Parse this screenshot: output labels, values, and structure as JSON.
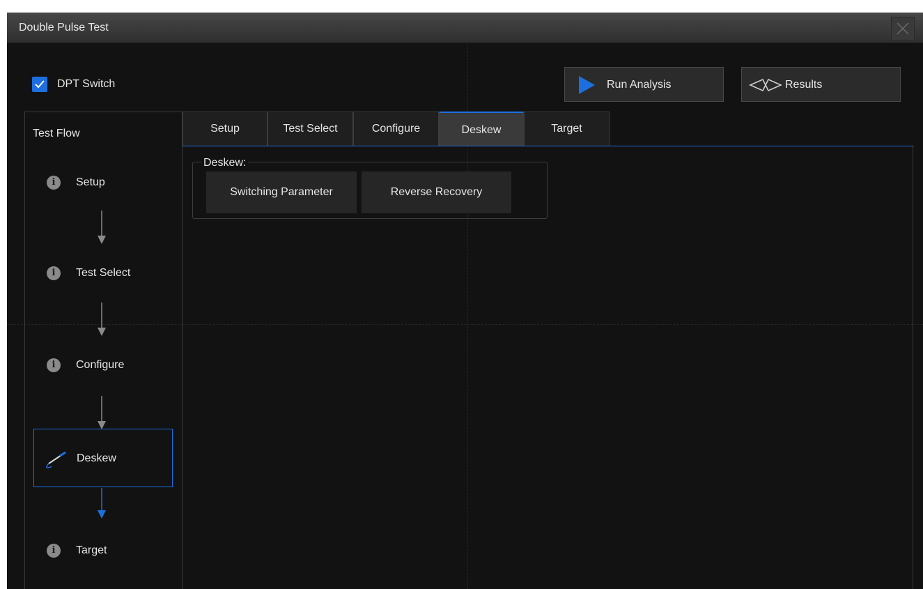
{
  "window": {
    "title": "Double Pulse Test",
    "close_icon": "close-icon"
  },
  "dpt_switch": {
    "label": "DPT Switch",
    "checked": true
  },
  "toolbar": {
    "run_analysis": {
      "label": "Run Analysis",
      "icon": "play-icon"
    },
    "results": {
      "label": "Results",
      "icon": "results-icon"
    }
  },
  "test_flow": {
    "heading": "Test Flow",
    "items": [
      {
        "label": "Setup",
        "icon": "info-icon",
        "active": false
      },
      {
        "label": "Test Select",
        "icon": "info-icon",
        "active": false
      },
      {
        "label": "Configure",
        "icon": "info-icon",
        "active": false
      },
      {
        "label": "Deskew",
        "icon": "probe-icon",
        "active": true
      },
      {
        "label": "Target",
        "icon": "info-icon",
        "active": false
      }
    ]
  },
  "tabs": [
    {
      "label": "Setup",
      "active": false
    },
    {
      "label": "Test Select",
      "active": false
    },
    {
      "label": "Configure",
      "active": false
    },
    {
      "label": "Deskew",
      "active": true
    },
    {
      "label": "Target",
      "active": false
    }
  ],
  "deskew_group": {
    "legend": "Deskew:",
    "buttons": [
      "Switching Parameter",
      "Reverse Recovery"
    ]
  },
  "colors": {
    "accent": "#1d6fe0",
    "background": "#121212",
    "text": "#e6e6e6",
    "inactive_icon": "#8a8a8a"
  }
}
